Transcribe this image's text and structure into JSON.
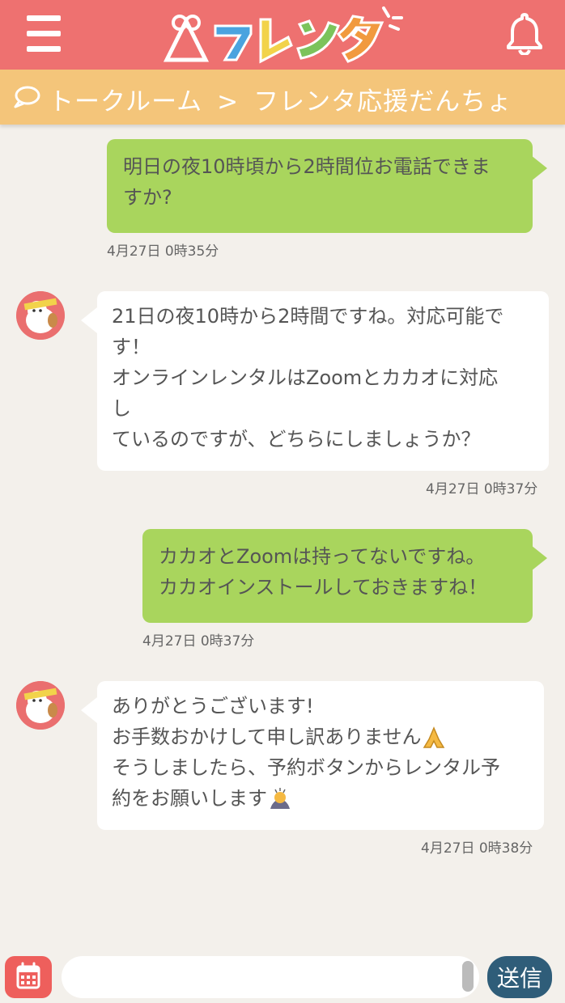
{
  "header": {
    "logo_text": "フレンタ",
    "menu_icon": "hamburger-menu-icon",
    "notification_icon": "bell-icon"
  },
  "breadcrumb": {
    "icon": "chat-bubble-icon",
    "parent": "トークルーム",
    "separator": ">",
    "current": "フレンタ応援だんちょ"
  },
  "messages": [
    {
      "side": "right",
      "lines": [
        "明日の夜10時頃から2時間位お電話できま",
        "すか?"
      ],
      "time": "4月27日 0時35分"
    },
    {
      "side": "left",
      "lines": [
        "21日の夜10時から2時間ですね。対応可能で",
        "す！",
        "オンラインレンタルはZoomとカカオに対応",
        "し",
        "ているのですが、どちらにしましょうか？"
      ],
      "time": "4月27日 0時37分"
    },
    {
      "side": "right",
      "lines": [
        "カカオとZoomは持ってないですね。",
        "カカオインストールしておきますね！"
      ],
      "time": "4月27日 0時37分"
    },
    {
      "side": "left",
      "lines": [
        "ありがとうございます!",
        "お手数おかけして申し訳ありません",
        "そうしましたら、予約ボタンからレンタル予",
        "約をお願いします"
      ],
      "emojis": [
        "folded-hands-emoji",
        "person-bowing-emoji"
      ],
      "time": "4月27日 0時38分"
    }
  ],
  "input_bar": {
    "calendar_icon": "calendar-icon",
    "placeholder": "",
    "send_label": "送信"
  },
  "colors": {
    "header": "#ee7170",
    "breadcrumb": "#f4c57a",
    "sent_bubble": "#a9d55d",
    "received_bubble": "#ffffff",
    "background": "#f3f0eb",
    "send_button": "#2f5d79",
    "calendar_button": "#ee5f5c"
  }
}
